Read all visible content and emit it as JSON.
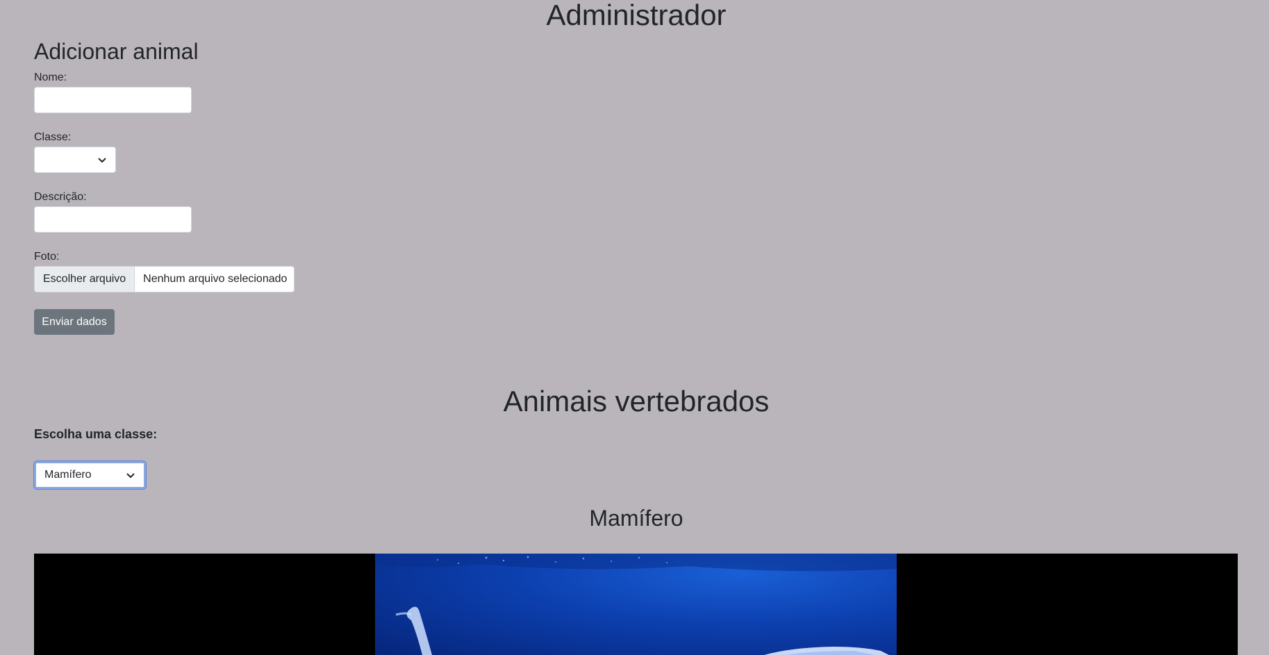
{
  "page": {
    "title": "Administrador"
  },
  "add_form": {
    "heading": "Adicionar animal",
    "name_label": "Nome:",
    "name_value": "",
    "class_label": "Classe:",
    "class_value": "",
    "description_label": "Descrição:",
    "description_value": "",
    "photo_label": "Foto:",
    "file_button": "Escolher arquivo",
    "file_status": "Nenhum arquivo selecionado",
    "submit_label": "Enviar dados"
  },
  "vertebrates": {
    "heading": "Animais vertebrados",
    "choose_label": "Escolha uma classe:",
    "selected_class": "Mamífero",
    "class_heading": "Mamífero",
    "image_subject": "whale-underwater-photo"
  },
  "colors": {
    "background": "#bab5bb",
    "button": "#6c757d",
    "focus_ring": "#8aa7e0"
  }
}
